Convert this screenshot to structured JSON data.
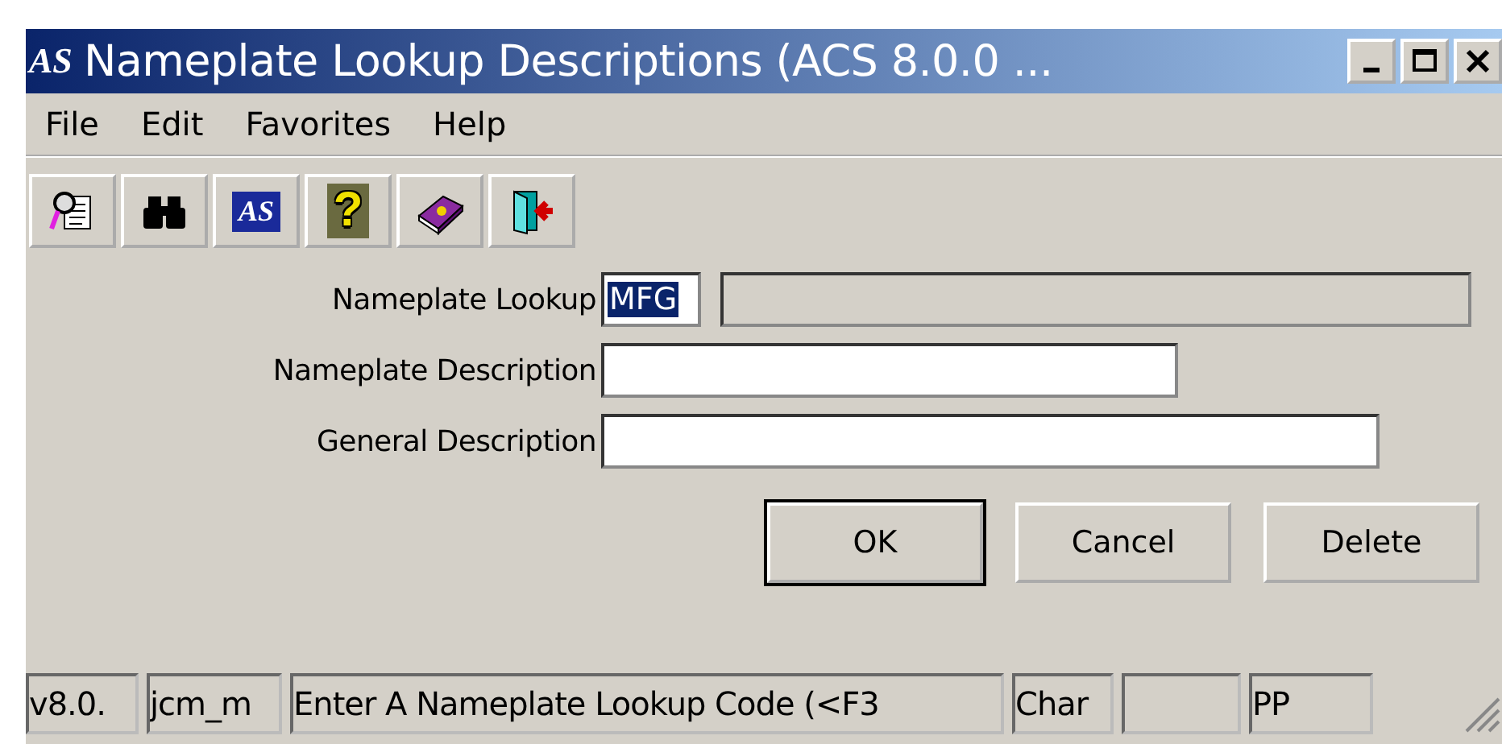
{
  "window": {
    "title": "Nameplate Lookup Descriptions (ACS 8.0.0 ...",
    "logo": "AS"
  },
  "menu": [
    "File",
    "Edit",
    "Favorites",
    "Help"
  ],
  "toolbar": [
    {
      "kind": "view"
    },
    {
      "kind": "find"
    },
    {
      "kind": "logo",
      "text": "AS"
    },
    {
      "kind": "help",
      "text": "?"
    },
    {
      "kind": "book"
    },
    {
      "kind": "exit"
    }
  ],
  "form": {
    "fields": [
      {
        "label": "Nameplate Lookup",
        "value": "MFG",
        "text_selected": true,
        "extra_disabled": true
      },
      {
        "label": "Nameplate Description"
      },
      {
        "label": "General Description"
      }
    ]
  },
  "buttons": [
    {
      "label": "OK",
      "default": true
    },
    {
      "label": "Cancel",
      "default": false
    },
    {
      "label": "Delete",
      "default": false
    }
  ],
  "status_bar": [
    {
      "kind": "text",
      "text": "v8.0."
    },
    {
      "kind": "text",
      "text": "jcm_m"
    },
    {
      "kind": "text",
      "text": "Enter A Nameplate Lookup Code (<F3"
    },
    {
      "kind": "text",
      "text": "Char"
    },
    {
      "kind": "blank"
    },
    {
      "kind": "text",
      "text": "PP"
    }
  ]
}
